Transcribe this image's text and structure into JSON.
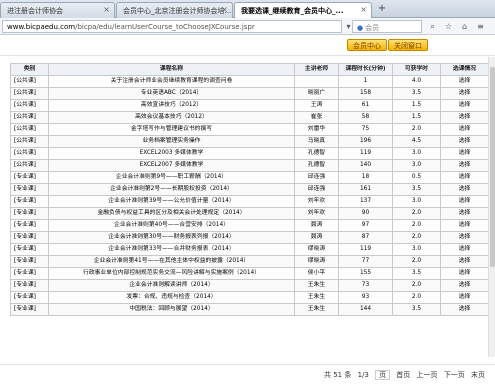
{
  "tabs": [
    {
      "label": "进注册会计师协会",
      "active": false
    },
    {
      "label": "会员中心_北京注册会计师协会培...",
      "active": false
    },
    {
      "label": "我要选课_继续教育_会员中心_...",
      "active": true
    }
  ],
  "new_tab_label": "+",
  "address": {
    "host": "www.bicpaedu.com",
    "path": "/bicpa/edu/learnUserCourse_toChooseJXCourse.jspr",
    "search_placeholder": "会员"
  },
  "header": {
    "member_center_label": "会员中心",
    "close_window_label": "关闭窗口"
  },
  "table": {
    "columns": [
      "类别",
      "课程名称",
      "主讲老师",
      "课程时长(分钟)",
      "可获学时",
      "选课情况"
    ],
    "rows": [
      [
        "[公共课]",
        "关于注册会计师业会员继续教育课程的调查问卷",
        "",
        "1",
        "4.0",
        "选择"
      ],
      [
        "[公共课]",
        "专业英语ABC（2014）",
        "晓丽广",
        "158",
        "3.5",
        "选择"
      ],
      [
        "[公共课]",
        "高效宣讲技巧（2012）",
        "王涛",
        "61",
        "1.5",
        "选择"
      ],
      [
        "[公共课]",
        "高效会议基本技巧（2012）",
        "崔张",
        "58",
        "1.5",
        "选择"
      ],
      [
        "[公共课]",
        "金字塔写作与管理建议书的撰写",
        "刘雷华",
        "75",
        "2.0",
        "选择"
      ],
      [
        "[公共课]",
        "业务档案管理实务操作",
        "马晓真",
        "196",
        "4.5",
        "选择"
      ],
      [
        "[公共课]",
        "EXCEL2003 多媒体教学",
        "孔德智",
        "119",
        "3.0",
        "选择"
      ],
      [
        "[公共课]",
        "EXCEL2007 多媒体教学",
        "孔德智",
        "140",
        "3.0",
        "选择"
      ],
      [
        "[专业课]",
        "企业会计准则第9号——职工薪酬（2014）",
        "邱连强",
        "18",
        "0.5",
        "选择"
      ],
      [
        "[专业课]",
        "企业会计准则第2号——长期股权投资（2014）",
        "邱连强",
        "161",
        "3.5",
        "选择"
      ],
      [
        "[专业课]",
        "企业会计准则第39号——公允价值计量（2014）",
        "刘年欢",
        "137",
        "3.0",
        "选择"
      ],
      [
        "[专业课]",
        "金融负债与权益工具的区分及相关会计处理规定（2014）",
        "刘年欢",
        "90",
        "2.0",
        "选择"
      ],
      [
        "[专业课]",
        "企业会计准则第40号——合营安排（2014）",
        "聂涛",
        "97",
        "2.0",
        "选择"
      ],
      [
        "[专业课]",
        "企业会计准则第30号——财务报表列报（2014）",
        "聂涛",
        "87",
        "2.0",
        "选择"
      ],
      [
        "[专业课]",
        "企业会计准则第33号——合并财务报表（2014）",
        "缪晓涛",
        "119",
        "3.0",
        "选择"
      ],
      [
        "[专业课]",
        "企业会计准则第41号——在其他主体中权益的披露（2014）",
        "缪晓涛",
        "77",
        "2.0",
        "选择"
      ],
      [
        "[专业课]",
        "行政事业单位内部控制规范实务交流—风险讲解与实施案例（2014）",
        "侯小平",
        "155",
        "3.5",
        "选择"
      ],
      [
        "[专业课]",
        "企业会计准则解读讲师（2014）",
        "王朱生",
        "73",
        "2.0",
        "选择"
      ],
      [
        "[专业课]",
        "发票：合规、违规与检查（2014）",
        "王朱生",
        "93",
        "2.0",
        "选择"
      ],
      [
        "[专业课]",
        "中国税法：回顾与展望（2014）",
        "王朱生",
        "144",
        "3.5",
        "选择"
      ]
    ]
  },
  "pager": {
    "total_label": "共 51 条",
    "page_label": "1/3",
    "page_input": "页",
    "first_label": "首页",
    "prev_label": "上一页",
    "next_label": "下一页",
    "last_label": "末页"
  },
  "colors": {
    "header_button": "#f4b400",
    "header_bg": "#eef1f5"
  },
  "icons": {
    "search": "search-icon",
    "close_tab": "close-icon"
  }
}
